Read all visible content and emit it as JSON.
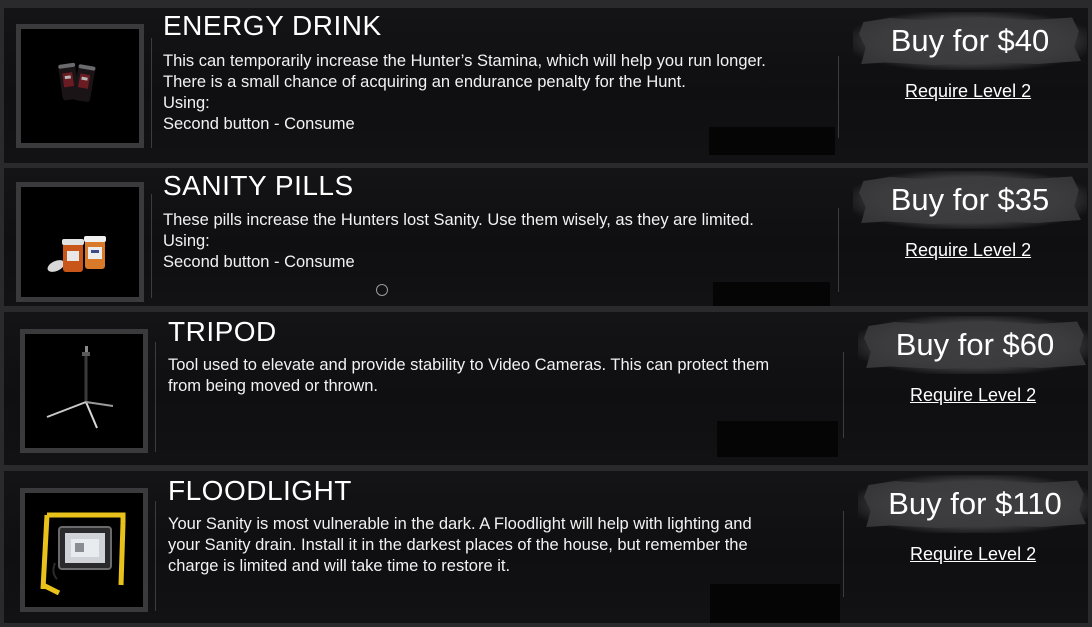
{
  "items": [
    {
      "title": "ENERGY DRINK",
      "description": [
        "This can temporarily increase the Hunter’s Stamina, which will help you run longer.",
        "There is a small chance of acquiring an endurance penalty for the Hunt."
      ],
      "using_label": "Using:",
      "using_action": "Second button - Consume",
      "buy_label": "Buy for $40",
      "requirement": "Require Level 2",
      "icon": "energy-drink-cans-icon"
    },
    {
      "title": "SANITY PILLS",
      "description": [
        "These pills increase the Hunters lost Sanity. Use them wisely, as they are limited."
      ],
      "using_label": "Using:",
      "using_action": "Second button - Consume",
      "buy_label": "Buy for $35",
      "requirement": "Require Level 2",
      "icon": "pill-bottles-icon"
    },
    {
      "title": "TRIPOD",
      "description": [
        "Tool used to elevate and provide stability to Video Cameras. This can protect them",
        "from being moved or thrown."
      ],
      "buy_label": "Buy for $60",
      "requirement": "Require Level 2",
      "icon": "tripod-icon"
    },
    {
      "title": "FLOODLIGHT",
      "description": [
        "Your Sanity is most vulnerable in the dark. A Floodlight will help with lighting and",
        "your Sanity drain. Install it in the darkest places of the house, but remember the",
        "charge is limited and will take time to restore it."
      ],
      "buy_label": "Buy for $110",
      "requirement": "Require Level 2",
      "icon": "floodlight-icon"
    }
  ],
  "colors": {
    "panel": "#121214",
    "separator": "#2a2a2c",
    "frame": "#3a3a3c",
    "button": "#4a4a4c",
    "text": "#ffffff",
    "floodlight_yellow": "#e8c21a"
  }
}
